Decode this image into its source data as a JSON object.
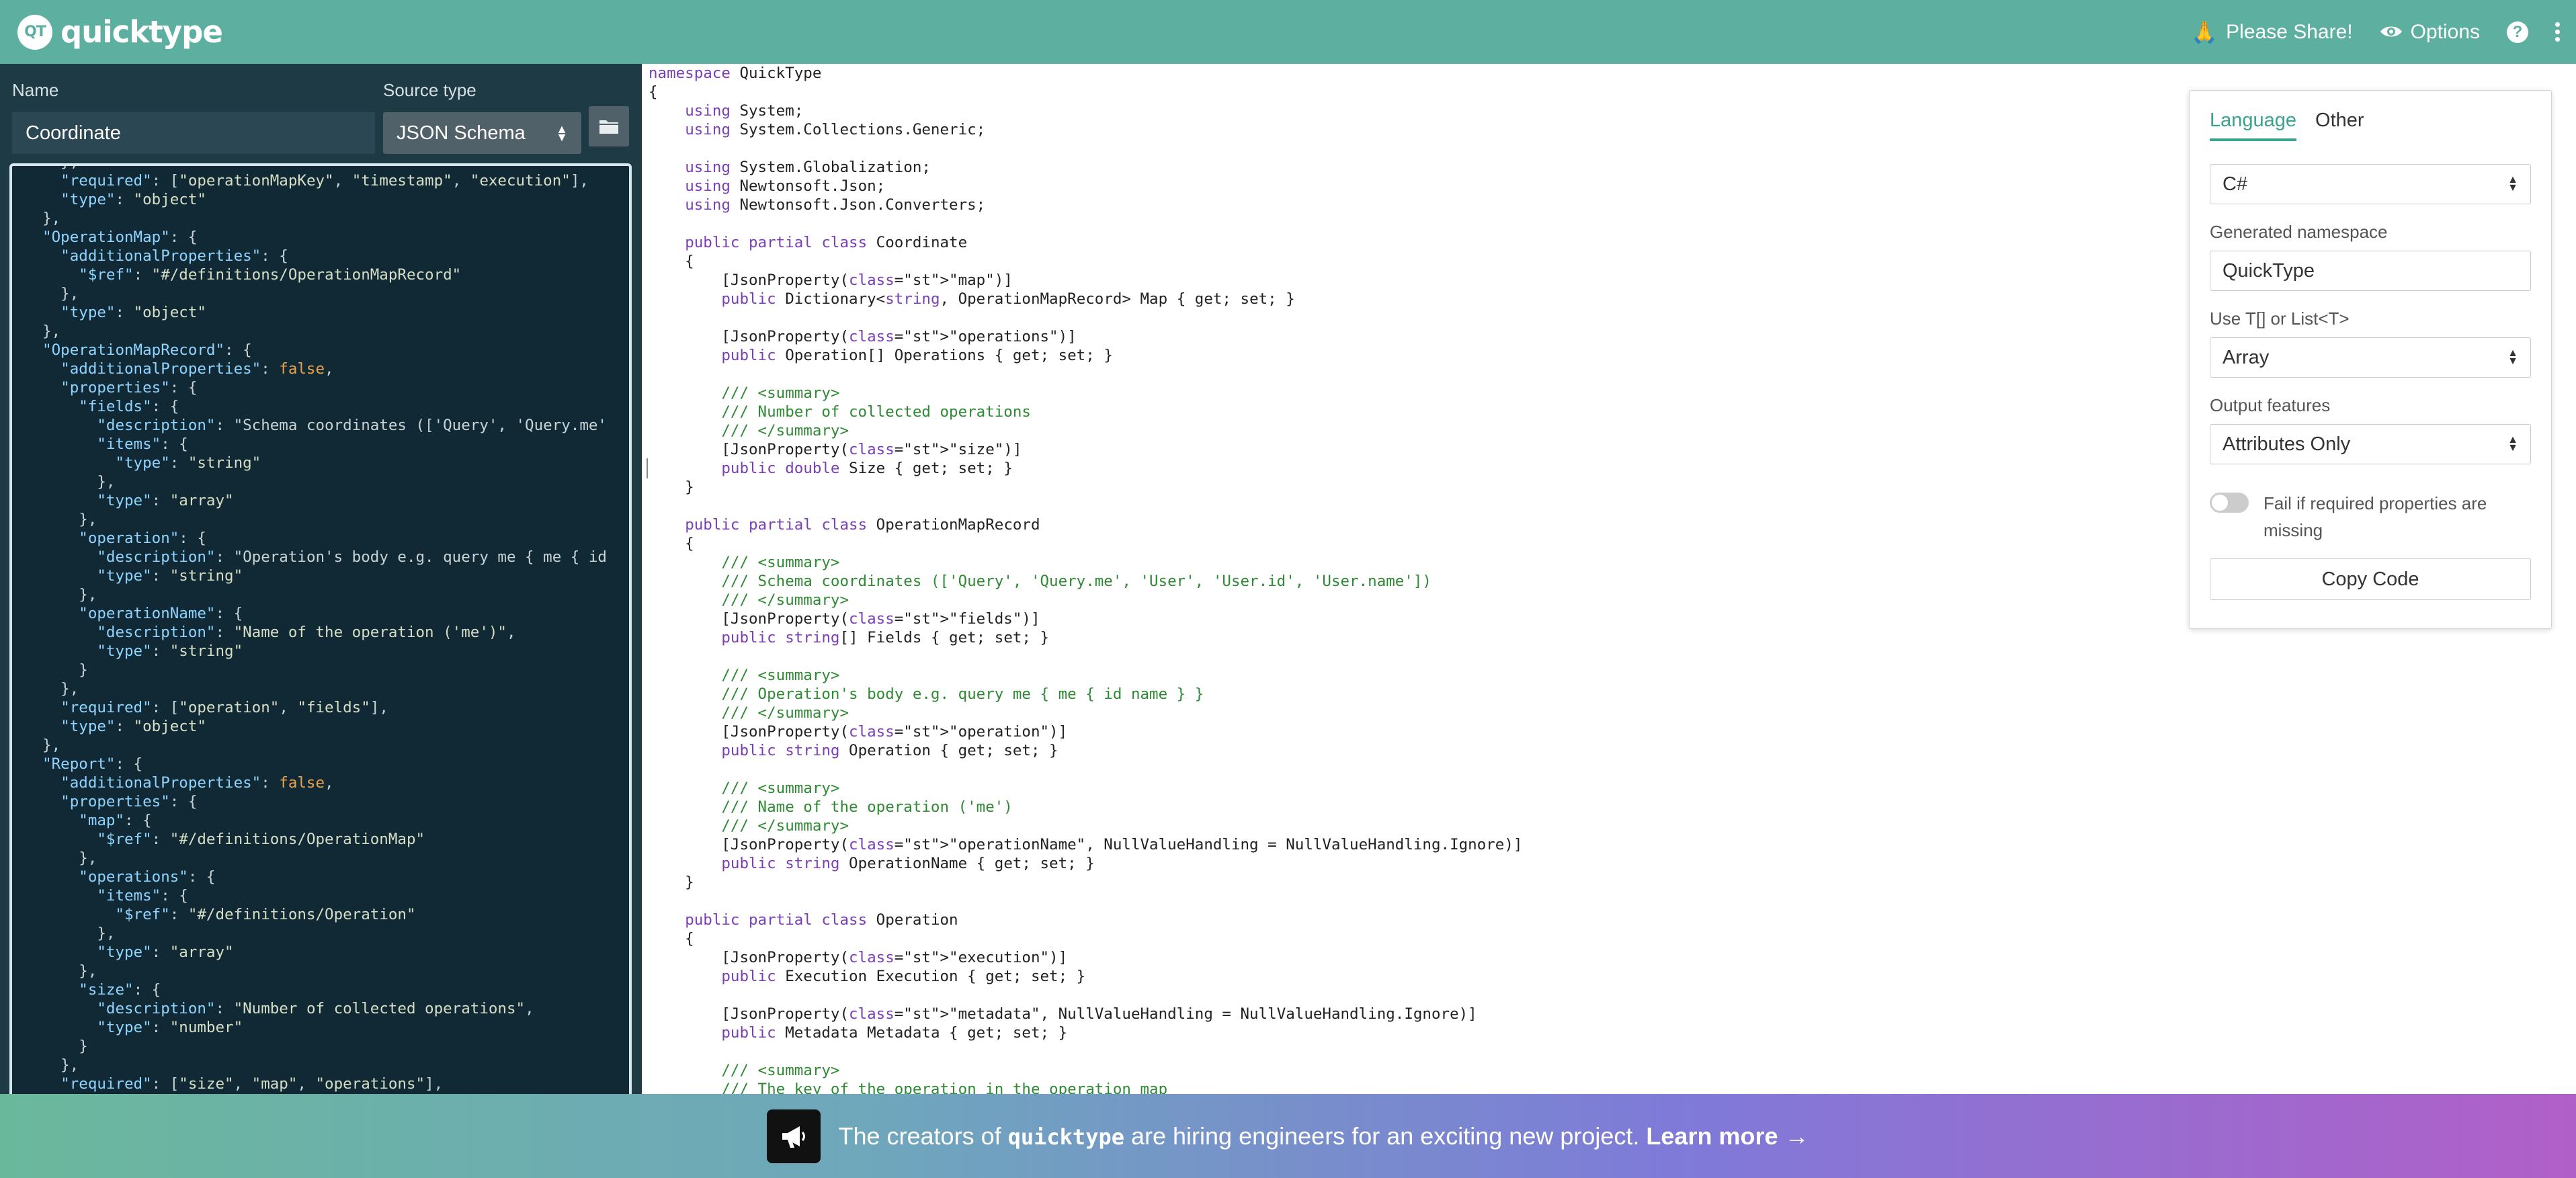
{
  "topbar": {
    "logo_mark": "QT",
    "logo_text": "quicktype",
    "share_label": "Please Share!",
    "options_label": "Options",
    "help_glyph": "?"
  },
  "left": {
    "name_label": "Name",
    "name_value": "Coordinate",
    "source_type_label": "Source type",
    "source_type_value": "JSON Schema"
  },
  "json_lines": [
    "    },",
    "    \"required\": [\"operationMapKey\", \"timestamp\", \"execution\"],",
    "    \"type\": \"object\"",
    "  },",
    "  \"OperationMap\": {",
    "    \"additionalProperties\": {",
    "      \"$ref\": \"#/definitions/OperationMapRecord\"",
    "    },",
    "    \"type\": \"object\"",
    "  },",
    "  \"OperationMapRecord\": {",
    "    \"additionalProperties\": false,",
    "    \"properties\": {",
    "      \"fields\": {",
    "        \"description\": \"Schema coordinates (['Query', 'Query.me'",
    "        \"items\": {",
    "          \"type\": \"string\"",
    "        },",
    "        \"type\": \"array\"",
    "      },",
    "      \"operation\": {",
    "        \"description\": \"Operation's body e.g. query me { me { id",
    "        \"type\": \"string\"",
    "      },",
    "      \"operationName\": {",
    "        \"description\": \"Name of the operation ('me')\",",
    "        \"type\": \"string\"",
    "      }",
    "    },",
    "    \"required\": [\"operation\", \"fields\"],",
    "    \"type\": \"object\"",
    "  },",
    "  \"Report\": {",
    "    \"additionalProperties\": false,",
    "    \"properties\": {",
    "      \"map\": {",
    "        \"$ref\": \"#/definitions/OperationMap\"",
    "      },",
    "      \"operations\": {",
    "        \"items\": {",
    "          \"$ref\": \"#/definitions/Operation\"",
    "        },",
    "        \"type\": \"array\"",
    "      },",
    "      \"size\": {",
    "        \"description\": \"Number of collected operations\",",
    "        \"type\": \"number\"",
    "      }",
    "    },",
    "    \"required\": [\"size\", \"map\", \"operations\"],"
  ],
  "cs_lines": [
    "namespace QuickType",
    "{",
    "    using System;",
    "    using System.Collections.Generic;",
    "",
    "    using System.Globalization;",
    "    using Newtonsoft.Json;",
    "    using Newtonsoft.Json.Converters;",
    "",
    "    public partial class Coordinate",
    "    {",
    "        [JsonProperty(\"map\")]",
    "        public Dictionary<string, OperationMapRecord> Map { get; set; }",
    "",
    "        [JsonProperty(\"operations\")]",
    "        public Operation[] Operations { get; set; }",
    "",
    "        /// <summary>",
    "        /// Number of collected operations",
    "        /// </summary>",
    "        [JsonProperty(\"size\")]",
    "        public double Size { get; set; }",
    "    }",
    "",
    "    public partial class OperationMapRecord",
    "    {",
    "        /// <summary>",
    "        /// Schema coordinates (['Query', 'Query.me', 'User', 'User.id', 'User.name'])",
    "        /// </summary>",
    "        [JsonProperty(\"fields\")]",
    "        public string[] Fields { get; set; }",
    "",
    "        /// <summary>",
    "        /// Operation's body e.g. query me { me { id name } }",
    "        /// </summary>",
    "        [JsonProperty(\"operation\")]",
    "        public string Operation { get; set; }",
    "",
    "        /// <summary>",
    "        /// Name of the operation ('me')",
    "        /// </summary>",
    "        [JsonProperty(\"operationName\", NullValueHandling = NullValueHandling.Ignore)]",
    "        public string OperationName { get; set; }",
    "    }",
    "",
    "    public partial class Operation",
    "    {",
    "        [JsonProperty(\"execution\")]",
    "        public Execution Execution { get; set; }",
    "",
    "        [JsonProperty(\"metadata\", NullValueHandling = NullValueHandling.Ignore)]",
    "        public Metadata Metadata { get; set; }",
    "",
    "        /// <summary>",
    "        /// The key of the operation in the operation map"
  ],
  "options_panel": {
    "tabs": [
      {
        "label": "Language",
        "active": true
      },
      {
        "label": "Other",
        "active": false
      }
    ],
    "language_value": "C#",
    "namespace_label": "Generated namespace",
    "namespace_value": "QuickType",
    "collection_label": "Use T[] or List<T>",
    "collection_value": "Array",
    "output_label": "Output features",
    "output_value": "Attributes Only",
    "fail_toggle_label": "Fail if required properties are missing",
    "fail_toggle_on": false,
    "copy_label": "Copy Code"
  },
  "banner": {
    "text_prefix": "The creators of ",
    "brand": "quicktype",
    "text_middle": " are hiring engineers for an exciting new project. ",
    "link": "Learn more →"
  },
  "colors": {
    "topbar": "#5dafa0",
    "editor_bg": "#112934",
    "accent": "#3aa38f"
  }
}
